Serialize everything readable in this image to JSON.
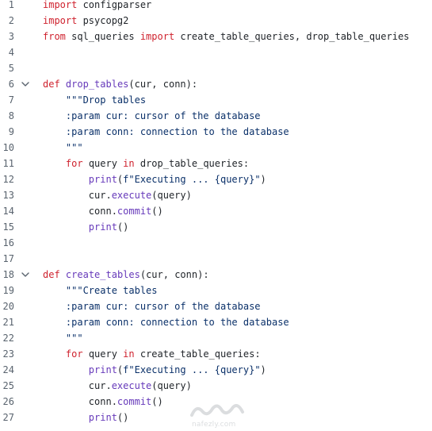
{
  "colors": {
    "keyword": "#cf222e",
    "function": "#6639ba",
    "string": "#0a3069",
    "plain": "#1f2328",
    "line_number": "#59636e"
  },
  "lines": [
    {
      "num": "1",
      "fold": false,
      "tokens": [
        {
          "t": "kw",
          "v": "import"
        },
        {
          "t": "plain",
          "v": " configparser"
        }
      ]
    },
    {
      "num": "2",
      "fold": false,
      "tokens": [
        {
          "t": "kw",
          "v": "import"
        },
        {
          "t": "plain",
          "v": " psycopg2"
        }
      ]
    },
    {
      "num": "3",
      "fold": false,
      "tokens": [
        {
          "t": "kw",
          "v": "from"
        },
        {
          "t": "plain",
          "v": " sql_queries "
        },
        {
          "t": "kw",
          "v": "import"
        },
        {
          "t": "plain",
          "v": " create_table_queries, drop_table_queries"
        }
      ]
    },
    {
      "num": "4",
      "fold": false,
      "tokens": []
    },
    {
      "num": "5",
      "fold": false,
      "tokens": []
    },
    {
      "num": "6",
      "fold": true,
      "tokens": [
        {
          "t": "kw",
          "v": "def"
        },
        {
          "t": "plain",
          "v": " "
        },
        {
          "t": "fn",
          "v": "drop_tables"
        },
        {
          "t": "plain",
          "v": "(cur, conn):"
        }
      ]
    },
    {
      "num": "7",
      "fold": false,
      "tokens": [
        {
          "t": "str",
          "v": "    \"\"\"Drop tables"
        }
      ]
    },
    {
      "num": "8",
      "fold": false,
      "tokens": [
        {
          "t": "str",
          "v": "    :param cur: cursor of the database"
        }
      ]
    },
    {
      "num": "9",
      "fold": false,
      "tokens": [
        {
          "t": "str",
          "v": "    :param conn: connection to the database"
        }
      ]
    },
    {
      "num": "10",
      "fold": false,
      "tokens": [
        {
          "t": "str",
          "v": "    \"\"\""
        }
      ]
    },
    {
      "num": "11",
      "fold": false,
      "tokens": [
        {
          "t": "plain",
          "v": "    "
        },
        {
          "t": "kw",
          "v": "for"
        },
        {
          "t": "plain",
          "v": " query "
        },
        {
          "t": "kw",
          "v": "in"
        },
        {
          "t": "plain",
          "v": " drop_table_queries:"
        }
      ]
    },
    {
      "num": "12",
      "fold": false,
      "tokens": [
        {
          "t": "plain",
          "v": "        "
        },
        {
          "t": "fn",
          "v": "print"
        },
        {
          "t": "plain",
          "v": "("
        },
        {
          "t": "str",
          "v": "f\"Executing ... {query}\""
        },
        {
          "t": "plain",
          "v": ")"
        }
      ]
    },
    {
      "num": "13",
      "fold": false,
      "tokens": [
        {
          "t": "plain",
          "v": "        cur."
        },
        {
          "t": "fn",
          "v": "execute"
        },
        {
          "t": "plain",
          "v": "(query)"
        }
      ]
    },
    {
      "num": "14",
      "fold": false,
      "tokens": [
        {
          "t": "plain",
          "v": "        conn."
        },
        {
          "t": "fn",
          "v": "commit"
        },
        {
          "t": "plain",
          "v": "()"
        }
      ]
    },
    {
      "num": "15",
      "fold": false,
      "tokens": [
        {
          "t": "plain",
          "v": "        "
        },
        {
          "t": "fn",
          "v": "print"
        },
        {
          "t": "plain",
          "v": "()"
        }
      ]
    },
    {
      "num": "16",
      "fold": false,
      "tokens": []
    },
    {
      "num": "17",
      "fold": false,
      "tokens": []
    },
    {
      "num": "18",
      "fold": true,
      "tokens": [
        {
          "t": "kw",
          "v": "def"
        },
        {
          "t": "plain",
          "v": " "
        },
        {
          "t": "fn",
          "v": "create_tables"
        },
        {
          "t": "plain",
          "v": "(cur, conn):"
        }
      ]
    },
    {
      "num": "19",
      "fold": false,
      "tokens": [
        {
          "t": "str",
          "v": "    \"\"\"Create tables"
        }
      ]
    },
    {
      "num": "20",
      "fold": false,
      "tokens": [
        {
          "t": "str",
          "v": "    :param cur: cursor of the database"
        }
      ]
    },
    {
      "num": "21",
      "fold": false,
      "tokens": [
        {
          "t": "str",
          "v": "    :param conn: connection to the database"
        }
      ]
    },
    {
      "num": "22",
      "fold": false,
      "tokens": [
        {
          "t": "str",
          "v": "    \"\"\""
        }
      ]
    },
    {
      "num": "23",
      "fold": false,
      "tokens": [
        {
          "t": "plain",
          "v": "    "
        },
        {
          "t": "kw",
          "v": "for"
        },
        {
          "t": "plain",
          "v": " query "
        },
        {
          "t": "kw",
          "v": "in"
        },
        {
          "t": "plain",
          "v": " create_table_queries:"
        }
      ]
    },
    {
      "num": "24",
      "fold": false,
      "tokens": [
        {
          "t": "plain",
          "v": "        "
        },
        {
          "t": "fn",
          "v": "print"
        },
        {
          "t": "plain",
          "v": "("
        },
        {
          "t": "str",
          "v": "f\"Executing ... {query}\""
        },
        {
          "t": "plain",
          "v": ")"
        }
      ]
    },
    {
      "num": "25",
      "fold": false,
      "tokens": [
        {
          "t": "plain",
          "v": "        cur."
        },
        {
          "t": "fn",
          "v": "execute"
        },
        {
          "t": "plain",
          "v": "(query)"
        }
      ]
    },
    {
      "num": "26",
      "fold": false,
      "tokens": [
        {
          "t": "plain",
          "v": "        conn."
        },
        {
          "t": "fn",
          "v": "commit"
        },
        {
          "t": "plain",
          "v": "()"
        }
      ]
    },
    {
      "num": "27",
      "fold": false,
      "tokens": [
        {
          "t": "plain",
          "v": "        "
        },
        {
          "t": "fn",
          "v": "print"
        },
        {
          "t": "plain",
          "v": "()"
        }
      ]
    }
  ],
  "watermark": {
    "logo_text": "مستقل",
    "site": "nafezly.com"
  }
}
